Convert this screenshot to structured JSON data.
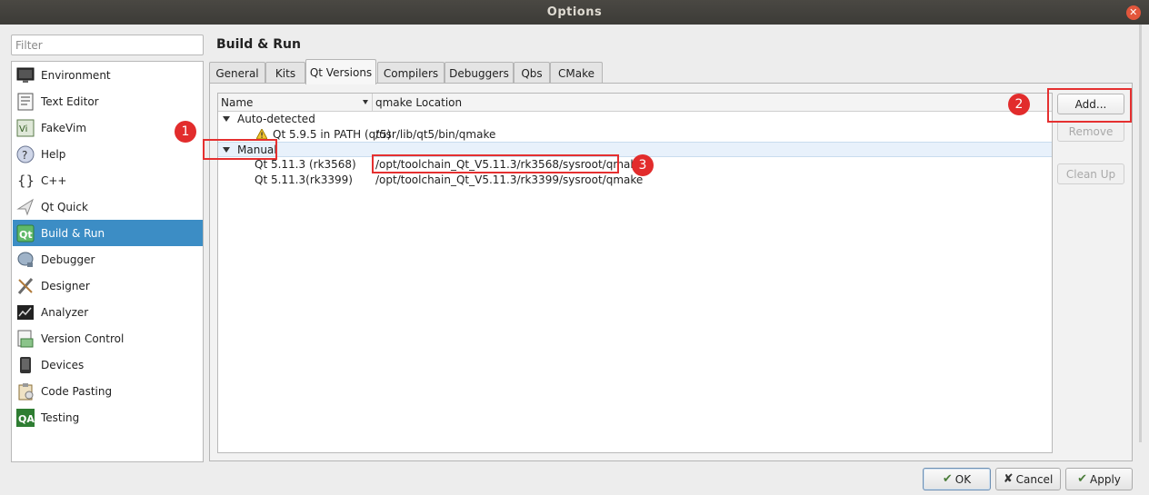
{
  "window": {
    "title": "Options"
  },
  "filter": {
    "placeholder": "Filter",
    "value": ""
  },
  "categories": [
    {
      "label": "Environment",
      "icon": "monitor-icon",
      "selected": false
    },
    {
      "label": "Text Editor",
      "icon": "text-editor-icon",
      "selected": false
    },
    {
      "label": "FakeVim",
      "icon": "fakevim-icon",
      "selected": false
    },
    {
      "label": "Help",
      "icon": "help-icon",
      "selected": false
    },
    {
      "label": "C++",
      "icon": "cpp-braces-icon",
      "selected": false
    },
    {
      "label": "Qt Quick",
      "icon": "qt-quick-icon",
      "selected": false
    },
    {
      "label": "Build & Run",
      "icon": "qt-build-icon",
      "selected": true
    },
    {
      "label": "Debugger",
      "icon": "debugger-icon",
      "selected": false
    },
    {
      "label": "Designer",
      "icon": "designer-icon",
      "selected": false
    },
    {
      "label": "Analyzer",
      "icon": "analyzer-icon",
      "selected": false
    },
    {
      "label": "Version Control",
      "icon": "version-control-icon",
      "selected": false
    },
    {
      "label": "Devices",
      "icon": "devices-icon",
      "selected": false
    },
    {
      "label": "Code Pasting",
      "icon": "code-pasting-icon",
      "selected": false
    },
    {
      "label": "Testing",
      "icon": "testing-qa-icon",
      "selected": false
    }
  ],
  "page": {
    "title": "Build & Run"
  },
  "tabs": [
    {
      "label": "General",
      "active": false
    },
    {
      "label": "Kits",
      "active": false
    },
    {
      "label": "Qt Versions",
      "active": true
    },
    {
      "label": "Compilers",
      "active": false
    },
    {
      "label": "Debuggers",
      "active": false
    },
    {
      "label": "Qbs",
      "active": false
    },
    {
      "label": "CMake",
      "active": false
    }
  ],
  "tree": {
    "columns": [
      "Name",
      "qmake Location"
    ],
    "groups": [
      {
        "label": "Auto-detected",
        "expanded": true,
        "items": [
          {
            "name": "Qt 5.9.5 in PATH (qt5)",
            "location": "/usr/lib/qt5/bin/qmake",
            "warning": true
          }
        ]
      },
      {
        "label": "Manual",
        "expanded": true,
        "items": [
          {
            "name": "Qt 5.11.3 (rk3568)",
            "location": "/opt/toolchain_Qt_V5.11.3/rk3568/sysroot/qmake",
            "warning": false
          },
          {
            "name": "Qt 5.11.3(rk3399)",
            "location": "/opt/toolchain_Qt_V5.11.3/rk3399/sysroot/qmake",
            "warning": false
          }
        ]
      }
    ]
  },
  "side_buttons": {
    "add": "Add...",
    "remove": "Remove",
    "cleanup": "Clean Up"
  },
  "dialog_buttons": {
    "ok": "OK",
    "cancel": "Cancel",
    "apply": "Apply"
  },
  "annotations": {
    "one": "1",
    "two": "2",
    "three": "3",
    "color": "#e53030"
  },
  "colors": {
    "selection": "#3c8dc5",
    "titlebar": "#3c3b37"
  }
}
